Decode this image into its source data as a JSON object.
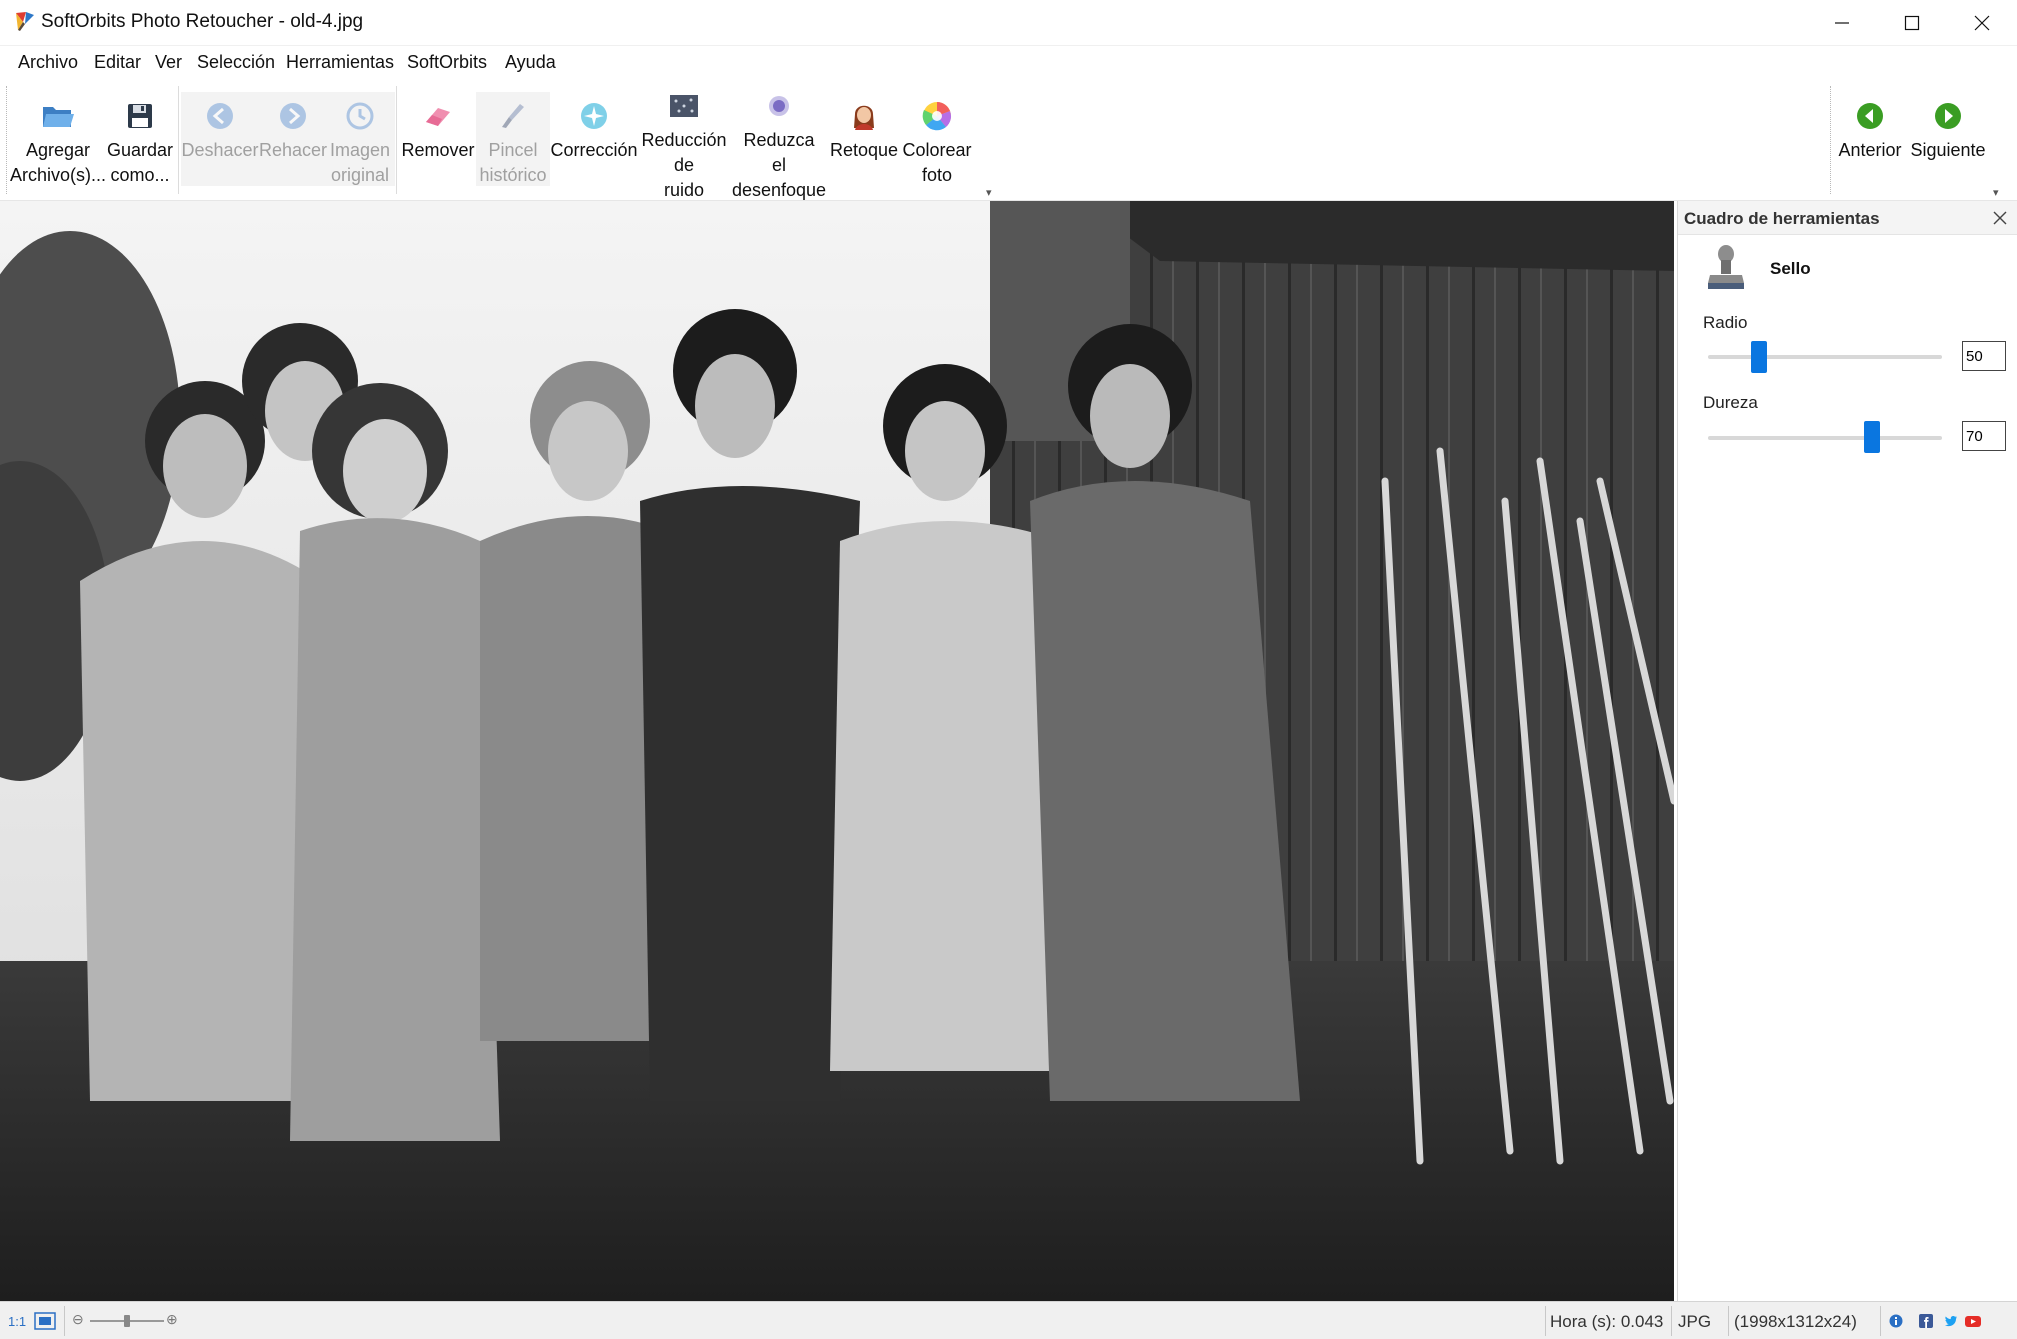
{
  "window": {
    "title": "SoftOrbits Photo Retoucher - old-4.jpg",
    "minimize_icon": "minimize-icon",
    "maximize_icon": "maximize-icon",
    "close_icon": "close-icon"
  },
  "menu": {
    "items": [
      "Archivo",
      "Editar",
      "Ver",
      "Selección",
      "Herramientas",
      "SoftOrbits",
      "Ayuda"
    ]
  },
  "toolbar": {
    "add_files": {
      "line1": "Agregar",
      "line2": "Archivo(s)...",
      "icon": "folder-open-icon"
    },
    "save_as": {
      "line1": "Guardar",
      "line2": "como...",
      "icon": "floppy-disk-icon"
    },
    "undo": {
      "line1": "Deshacer",
      "icon": "undo-icon"
    },
    "redo": {
      "line1": "Rehacer",
      "icon": "redo-icon"
    },
    "original": {
      "line1": "Imagen",
      "line2": "original",
      "icon": "history-icon"
    },
    "remove": {
      "line1": "Remover",
      "icon": "eraser-icon"
    },
    "history_brush": {
      "line1": "Pincel",
      "line2": "histórico",
      "icon": "brush-icon"
    },
    "correction": {
      "line1": "Corrección",
      "icon": "correction-icon"
    },
    "noise": {
      "line1": "Reducción",
      "line2": "de",
      "line3": "ruido",
      "icon": "noise-icon"
    },
    "deblur": {
      "line1": "Reduzca",
      "line2": "el",
      "line3": "desenfoque",
      "icon": "deblur-icon"
    },
    "retouch": {
      "line1": "Retoque",
      "icon": "face-icon"
    },
    "colorize": {
      "line1": "Colorear",
      "line2": "foto",
      "icon": "color-wheel-icon"
    },
    "previous": {
      "line1": "Anterior",
      "icon": "arrow-left-icon"
    },
    "next": {
      "line1": "Siguiente",
      "icon": "arrow-right-icon"
    },
    "colors": {
      "enabled_text": "#111111",
      "disabled_text": "#a0a0a0",
      "nav_green": "#3a9d23"
    }
  },
  "panel": {
    "title": "Cuadro de herramientas",
    "tool_name": "Sello",
    "tool_icon": "stamp-icon",
    "radius_label": "Radio",
    "radius_value": "50",
    "radius_fraction": 0.22,
    "hardness_label": "Dureza",
    "hardness_value": "70",
    "hardness_fraction": 0.7,
    "slider_color": "#0a76e0"
  },
  "status": {
    "zoom_ratio": "1:1",
    "time": "Hora (s): 0.043",
    "format": "JPG",
    "dimensions": "(1998x1312x24)",
    "zoom_fraction": 0.5,
    "icons": [
      "info-icon",
      "facebook-icon",
      "twitter-icon",
      "youtube-icon"
    ]
  }
}
